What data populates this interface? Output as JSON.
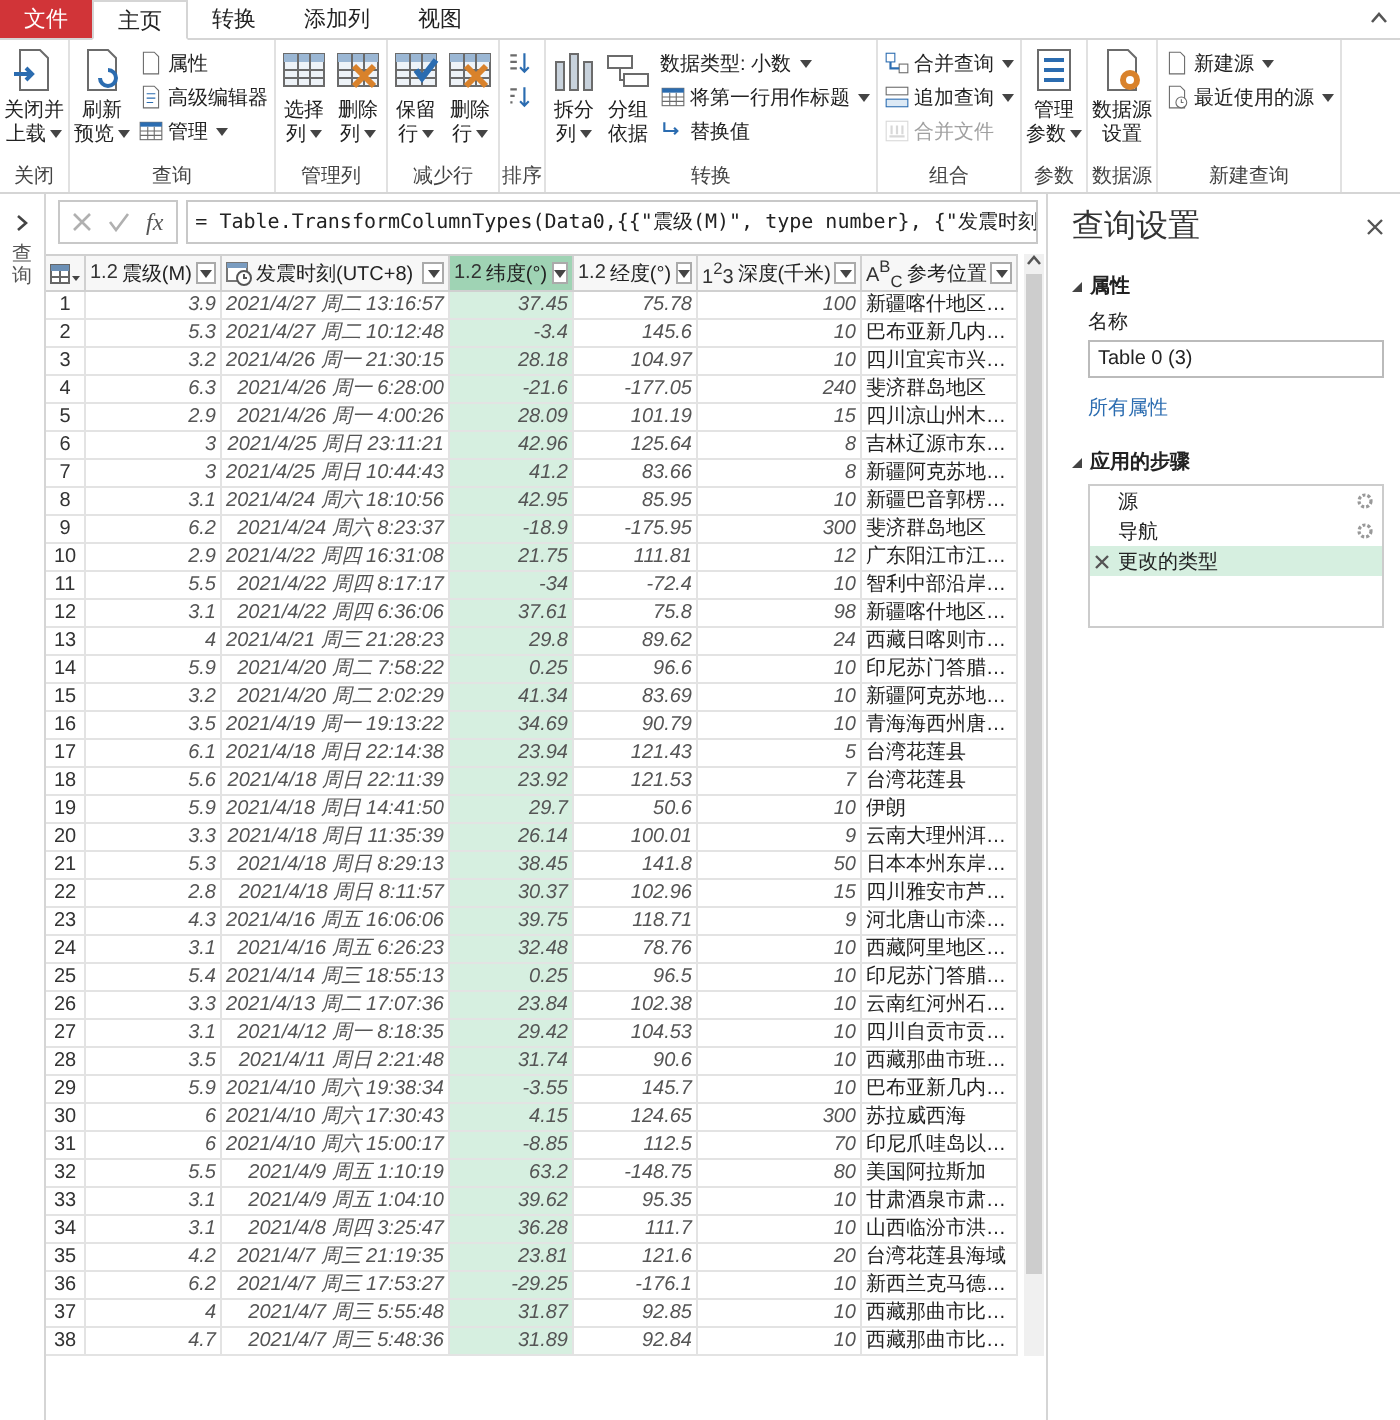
{
  "ribbon": {
    "tabs": [
      {
        "label": "文件",
        "kind": "file",
        "selected": false
      },
      {
        "label": "主页",
        "kind": "tab",
        "selected": true
      },
      {
        "label": "转换",
        "kind": "tab",
        "selected": false
      },
      {
        "label": "添加列",
        "kind": "tab",
        "selected": false
      },
      {
        "label": "视图",
        "kind": "tab",
        "selected": false
      }
    ],
    "groups": [
      {
        "label": "关闭",
        "items": [
          {
            "kind": "large",
            "lines": [
              "关闭并",
              "上载"
            ],
            "dropdown": true,
            "disabled": false
          }
        ]
      },
      {
        "label": "查询",
        "items": [
          {
            "kind": "large",
            "lines": [
              "刷新",
              "预览"
            ],
            "dropdown": true,
            "disabled": false
          },
          {
            "kind": "small",
            "lines": [
              "属性"
            ],
            "dropdown": false,
            "disabled": false
          },
          {
            "kind": "small",
            "lines": [
              "高级编辑器"
            ],
            "dropdown": false,
            "disabled": false
          },
          {
            "kind": "small",
            "lines": [
              "管理"
            ],
            "dropdown": true,
            "disabled": false
          }
        ]
      },
      {
        "label": "管理列",
        "items": [
          {
            "kind": "large",
            "lines": [
              "选择",
              "列"
            ],
            "dropdown": true,
            "disabled": false
          },
          {
            "kind": "large",
            "lines": [
              "删除",
              "列"
            ],
            "dropdown": true,
            "disabled": false
          }
        ]
      },
      {
        "label": "减少行",
        "items": [
          {
            "kind": "large",
            "lines": [
              "保留",
              "行"
            ],
            "dropdown": true,
            "disabled": false
          },
          {
            "kind": "large",
            "lines": [
              "删除",
              "行"
            ],
            "dropdown": true,
            "disabled": false
          }
        ]
      },
      {
        "label": "排序",
        "items": [
          {
            "kind": "icon",
            "dropdown": false,
            "disabled": false
          },
          {
            "kind": "icon",
            "dropdown": false,
            "disabled": false
          }
        ]
      },
      {
        "label": "转换",
        "items": [
          {
            "kind": "large",
            "lines": [
              "拆分",
              "列"
            ],
            "dropdown": true,
            "disabled": false
          },
          {
            "kind": "large",
            "lines": [
              "分组",
              "依据"
            ],
            "dropdown": false,
            "disabled": false
          },
          {
            "kind": "small",
            "lines": [
              "数据类型: 小数"
            ],
            "dropdown": true,
            "disabled": false
          },
          {
            "kind": "small",
            "lines": [
              "将第一行用作标题"
            ],
            "dropdown": true,
            "disabled": false
          },
          {
            "kind": "small",
            "lines": [
              "替换值"
            ],
            "dropdown": false,
            "disabled": false
          }
        ]
      },
      {
        "label": "组合",
        "items": [
          {
            "kind": "small",
            "lines": [
              "合并查询"
            ],
            "dropdown": true,
            "disabled": false
          },
          {
            "kind": "small",
            "lines": [
              "追加查询"
            ],
            "dropdown": true,
            "disabled": false
          },
          {
            "kind": "small",
            "lines": [
              "合并文件"
            ],
            "dropdown": false,
            "disabled": true
          }
        ]
      },
      {
        "label": "参数",
        "items": [
          {
            "kind": "large",
            "lines": [
              "管理",
              "参数"
            ],
            "dropdown": true,
            "disabled": false
          }
        ]
      },
      {
        "label": "数据源",
        "items": [
          {
            "kind": "large",
            "lines": [
              "数据源",
              "设置"
            ],
            "dropdown": false,
            "disabled": false
          }
        ]
      },
      {
        "label": "新建查询",
        "items": [
          {
            "kind": "small",
            "lines": [
              "新建源"
            ],
            "dropdown": true,
            "disabled": false
          },
          {
            "kind": "small",
            "lines": [
              "最近使用的源"
            ],
            "dropdown": true,
            "disabled": false
          }
        ]
      }
    ]
  },
  "queries_pane": {
    "label": "查询"
  },
  "formula_bar": {
    "fx": "fx",
    "formula": "= Table.TransformColumnTypes(Data0,{{\"震级(M)\", type number}, {\"发震时刻"
  },
  "table": {
    "columns": [
      {
        "type_label": "1.2",
        "name": "震级(M)",
        "selected": false
      },
      {
        "name": "发震时刻(UTC+8)",
        "selected": false
      },
      {
        "type_label": "1.2",
        "name": "纬度(°)",
        "selected": true
      },
      {
        "type_label": "1.2",
        "name": "经度(°)",
        "selected": false
      },
      {
        "type_label": "1$^{2}$3",
        "name": "深度(千米)",
        "selected": false
      },
      {
        "type_label": "A$^{B}$$_{C}$",
        "name": "参考位置",
        "selected": false
      }
    ],
    "rows": [
      {
        "n": "1",
        "cells": [
          "3.9",
          "2021/4/27 周二 13:16:57",
          "37.45",
          "75.78",
          "100",
          "新疆喀什地区…"
        ]
      },
      {
        "n": "2",
        "cells": [
          "5.3",
          "2021/4/27 周二 10:12:48",
          "-3.4",
          "145.6",
          "10",
          "巴布亚新几内…"
        ]
      },
      {
        "n": "3",
        "cells": [
          "3.2",
          "2021/4/26 周一 21:30:15",
          "28.18",
          "104.97",
          "10",
          "四川宜宾市兴…"
        ]
      },
      {
        "n": "4",
        "cells": [
          "6.3",
          "2021/4/26 周一 6:28:00",
          "-21.6",
          "-177.05",
          "240",
          "斐济群岛地区"
        ]
      },
      {
        "n": "5",
        "cells": [
          "2.9",
          "2021/4/26 周一 4:00:26",
          "28.09",
          "101.19",
          "15",
          "四川凉山州木…"
        ]
      },
      {
        "n": "6",
        "cells": [
          "3",
          "2021/4/25 周日 23:11:21",
          "42.96",
          "125.64",
          "8",
          "吉林辽源市东…"
        ]
      },
      {
        "n": "7",
        "cells": [
          "3",
          "2021/4/25 周日 10:44:43",
          "41.2",
          "83.66",
          "8",
          "新疆阿克苏地…"
        ]
      },
      {
        "n": "8",
        "cells": [
          "3.1",
          "2021/4/24 周六 18:10:56",
          "42.95",
          "85.95",
          "10",
          "新疆巴音郭楞…"
        ]
      },
      {
        "n": "9",
        "cells": [
          "6.2",
          "2021/4/24 周六 8:23:37",
          "-18.9",
          "-175.95",
          "300",
          "斐济群岛地区"
        ]
      },
      {
        "n": "10",
        "cells": [
          "2.9",
          "2021/4/22 周四 16:31:08",
          "21.75",
          "111.81",
          "12",
          "广东阳江市江…"
        ]
      },
      {
        "n": "11",
        "cells": [
          "5.5",
          "2021/4/22 周四 8:17:17",
          "-34",
          "-72.4",
          "10",
          "智利中部沿岸…"
        ]
      },
      {
        "n": "12",
        "cells": [
          "3.1",
          "2021/4/22 周四 6:36:06",
          "37.61",
          "75.8",
          "98",
          "新疆喀什地区…"
        ]
      },
      {
        "n": "13",
        "cells": [
          "4",
          "2021/4/21 周三 21:28:23",
          "29.8",
          "89.62",
          "24",
          "西藏日喀则市…"
        ]
      },
      {
        "n": "14",
        "cells": [
          "5.9",
          "2021/4/20 周二 7:58:22",
          "0.25",
          "96.6",
          "10",
          "印尼苏门答腊…"
        ]
      },
      {
        "n": "15",
        "cells": [
          "3.2",
          "2021/4/20 周二 2:02:29",
          "41.34",
          "83.69",
          "10",
          "新疆阿克苏地…"
        ]
      },
      {
        "n": "16",
        "cells": [
          "3.5",
          "2021/4/19 周一 19:13:22",
          "34.69",
          "90.79",
          "10",
          "青海海西州唐…"
        ]
      },
      {
        "n": "17",
        "cells": [
          "6.1",
          "2021/4/18 周日 22:14:38",
          "23.94",
          "121.43",
          "5",
          "台湾花莲县"
        ]
      },
      {
        "n": "18",
        "cells": [
          "5.6",
          "2021/4/18 周日 22:11:39",
          "23.92",
          "121.53",
          "7",
          "台湾花莲县"
        ]
      },
      {
        "n": "19",
        "cells": [
          "5.9",
          "2021/4/18 周日 14:41:50",
          "29.7",
          "50.6",
          "10",
          "伊朗"
        ]
      },
      {
        "n": "20",
        "cells": [
          "3.3",
          "2021/4/18 周日 11:35:39",
          "26.14",
          "100.01",
          "9",
          "云南大理州洱…"
        ]
      },
      {
        "n": "21",
        "cells": [
          "5.3",
          "2021/4/18 周日 8:29:13",
          "38.45",
          "141.8",
          "50",
          "日本本州东岸…"
        ]
      },
      {
        "n": "22",
        "cells": [
          "2.8",
          "2021/4/18 周日 8:11:57",
          "30.37",
          "102.96",
          "15",
          "四川雅安市芦…"
        ]
      },
      {
        "n": "23",
        "cells": [
          "4.3",
          "2021/4/16 周五 16:06:06",
          "39.75",
          "118.71",
          "9",
          "河北唐山市滦…"
        ]
      },
      {
        "n": "24",
        "cells": [
          "3.1",
          "2021/4/16 周五 6:26:23",
          "32.48",
          "78.76",
          "10",
          "西藏阿里地区…"
        ]
      },
      {
        "n": "25",
        "cells": [
          "5.4",
          "2021/4/14 周三 18:55:13",
          "0.25",
          "96.5",
          "10",
          "印尼苏门答腊…"
        ]
      },
      {
        "n": "26",
        "cells": [
          "3.3",
          "2021/4/13 周二 17:07:36",
          "23.84",
          "102.38",
          "10",
          "云南红河州石…"
        ]
      },
      {
        "n": "27",
        "cells": [
          "3.1",
          "2021/4/12 周一 8:18:35",
          "29.42",
          "104.53",
          "10",
          "四川自贡市贡…"
        ]
      },
      {
        "n": "28",
        "cells": [
          "3.5",
          "2021/4/11 周日 2:21:48",
          "31.74",
          "90.6",
          "10",
          "西藏那曲市班…"
        ]
      },
      {
        "n": "29",
        "cells": [
          "5.9",
          "2021/4/10 周六 19:38:34",
          "-3.55",
          "145.7",
          "10",
          "巴布亚新几内…"
        ]
      },
      {
        "n": "30",
        "cells": [
          "6",
          "2021/4/10 周六 17:30:43",
          "4.15",
          "124.65",
          "300",
          "苏拉威西海"
        ]
      },
      {
        "n": "31",
        "cells": [
          "6",
          "2021/4/10 周六 15:00:17",
          "-8.85",
          "112.5",
          "70",
          "印尼爪哇岛以…"
        ]
      },
      {
        "n": "32",
        "cells": [
          "5.5",
          "2021/4/9 周五 1:10:19",
          "63.2",
          "-148.75",
          "80",
          "美国阿拉斯加"
        ]
      },
      {
        "n": "33",
        "cells": [
          "3.1",
          "2021/4/9 周五 1:04:10",
          "39.62",
          "95.35",
          "10",
          "甘肃酒泉市肃…"
        ]
      },
      {
        "n": "34",
        "cells": [
          "3.1",
          "2021/4/8 周四 3:25:47",
          "36.28",
          "111.7",
          "10",
          "山西临汾市洪…"
        ]
      },
      {
        "n": "35",
        "cells": [
          "4.2",
          "2021/4/7 周三 21:19:35",
          "23.81",
          "121.6",
          "20",
          "台湾花莲县海域"
        ]
      },
      {
        "n": "36",
        "cells": [
          "6.2",
          "2021/4/7 周三 17:53:27",
          "-29.25",
          "-176.1",
          "10",
          "新西兰克马德…"
        ]
      },
      {
        "n": "37",
        "cells": [
          "4",
          "2021/4/7 周三 5:55:48",
          "31.87",
          "92.85",
          "10",
          "西藏那曲市比…"
        ]
      },
      {
        "n": "38",
        "cells": [
          "4.7",
          "2021/4/7 周三 5:48:36",
          "31.89",
          "92.84",
          "10",
          "西藏那曲市比…"
        ]
      }
    ]
  },
  "query_settings": {
    "title": "查询设置",
    "properties": {
      "heading": "属性",
      "name_label": "名称",
      "name_value": "Table 0 (3)",
      "link": "所有属性"
    },
    "steps": {
      "heading": "应用的步骤",
      "items": [
        {
          "label": "源",
          "selected": false,
          "has_settings": true
        },
        {
          "label": "导航",
          "selected": false,
          "has_settings": true
        },
        {
          "label": "更改的类型",
          "selected": true,
          "has_settings": false
        }
      ]
    }
  }
}
